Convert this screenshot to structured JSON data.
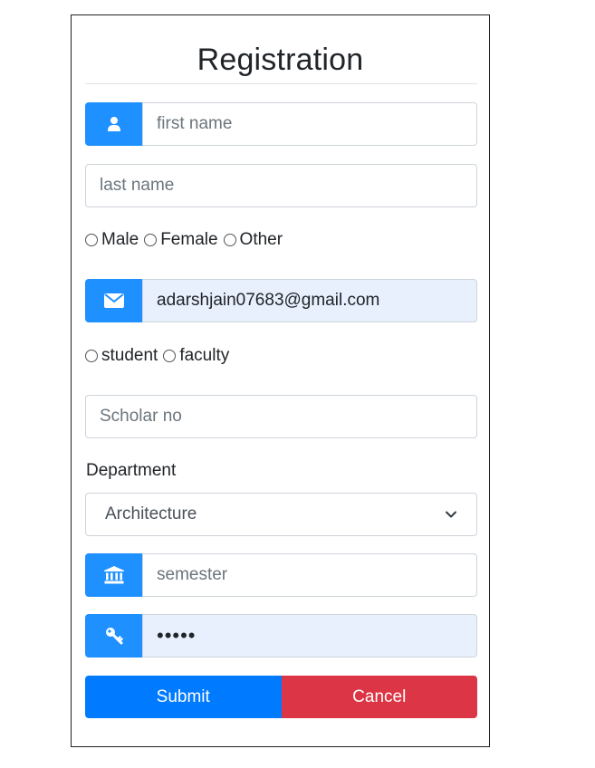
{
  "form": {
    "title": "Registration",
    "first_name": {
      "placeholder": "first name",
      "value": ""
    },
    "last_name": {
      "placeholder": "last name",
      "value": ""
    },
    "gender_options": [
      "Male",
      "Female",
      "Other"
    ],
    "email": {
      "value": "adarshjain07683@gmail.com"
    },
    "role_options": [
      "student",
      "faculty"
    ],
    "scholar_no": {
      "placeholder": "Scholar no",
      "value": ""
    },
    "department_label": "Department",
    "department_selected": "Architecture",
    "semester": {
      "placeholder": "semester",
      "value": ""
    },
    "password_mask": "•••••",
    "submit_label": "Submit",
    "cancel_label": "Cancel"
  },
  "icons": {
    "first_name": "user-icon",
    "email": "envelope-icon",
    "semester": "institution-icon",
    "password": "key-icon",
    "select": "chevron-down-icon"
  },
  "colors": {
    "addon": "#1e90ff",
    "submit": "#007bff",
    "cancel": "#dc3545",
    "autofill": "#e8f0fe"
  }
}
